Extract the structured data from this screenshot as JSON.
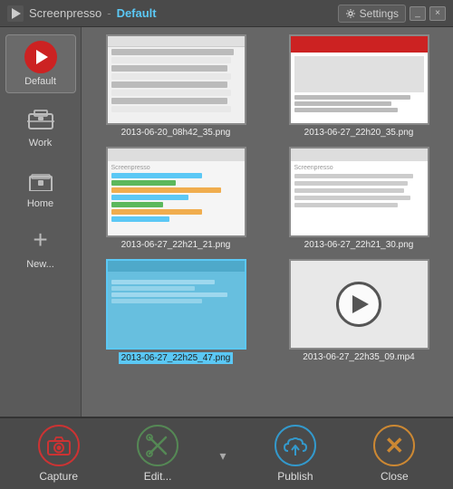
{
  "titleBar": {
    "appName": "Screenpresso",
    "separator": "-",
    "profile": "Default",
    "settingsLabel": "Settings",
    "minimizeLabel": "_",
    "closeLabel": "×"
  },
  "sidebar": {
    "items": [
      {
        "id": "default",
        "label": "Default",
        "active": true
      },
      {
        "id": "work",
        "label": "Work",
        "active": false
      },
      {
        "id": "home",
        "label": "Home",
        "active": false
      },
      {
        "id": "new",
        "label": "New...",
        "active": false
      }
    ]
  },
  "thumbnails": [
    {
      "id": "t1",
      "label": "2013-06-20_08h42_35.png",
      "selected": false,
      "type": "table"
    },
    {
      "id": "t2",
      "label": "2013-06-27_22h20_35.png",
      "selected": false,
      "type": "blog"
    },
    {
      "id": "t3",
      "label": "2013-06-27_22h21_21.png",
      "selected": false,
      "type": "chart"
    },
    {
      "id": "t4",
      "label": "2013-06-27_22h21_30.png",
      "selected": false,
      "type": "doc"
    },
    {
      "id": "t5",
      "label": "2013-06-27_22h25_47.png",
      "selected": true,
      "type": "chart2"
    },
    {
      "id": "t6",
      "label": "2013-06-27_22h35_09.mp4",
      "selected": false,
      "type": "video"
    }
  ],
  "toolbar": {
    "captureLabel": "Capture",
    "editLabel": "Edit...",
    "publishLabel": "Publish",
    "closeLabel": "Close"
  }
}
